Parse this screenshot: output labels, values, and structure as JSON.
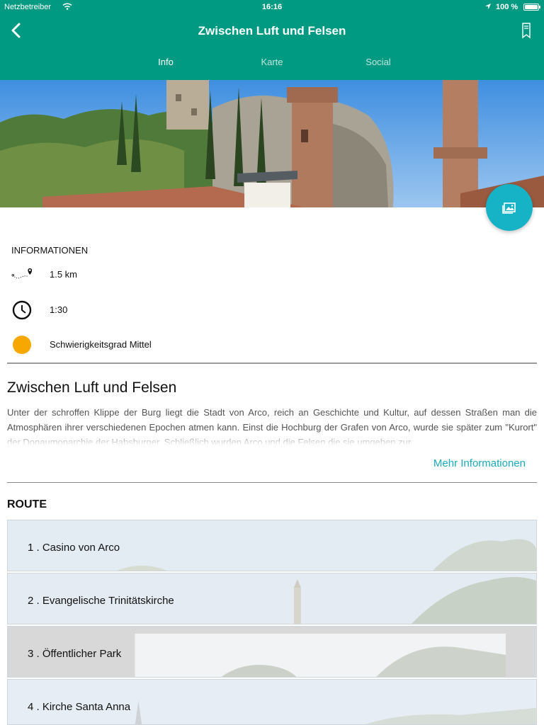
{
  "status_bar": {
    "carrier": "Netzbetreiber",
    "time": "16:16",
    "battery": "100 %"
  },
  "nav": {
    "title": "Zwischen Luft und Felsen",
    "back_icon": "chevron-left-icon",
    "bookmark_icon": "bookmark-icon"
  },
  "tabs": [
    {
      "label": "Info",
      "active": true
    },
    {
      "label": "Karte",
      "active": false
    },
    {
      "label": "Social",
      "active": false
    }
  ],
  "gallery_icon": "gallery-icon",
  "info": {
    "heading": "INFORMATIONEN",
    "distance": "1.5 km",
    "duration": "1:30",
    "difficulty": "Schwierigkeitsgrad Mittel",
    "difficulty_color": "#f6a800"
  },
  "tour": {
    "title": "Zwischen Luft und Felsen",
    "description": "Unter der schroffen Klippe der Burg liegt die Stadt von Arco, reich an Geschichte und Kultur, auf dessen Straßen man die Atmosphären ihrer verschiedenen Epochen atmen kann. Einst die Hochburg der Grafen von Arco, wurde sie später zum \"Kurort\" der Donaumonarchie der Habsburger. Schließlich wurden Arco und die Felsen die sie umgeben zur",
    "more_link": "Mehr Informationen"
  },
  "route": {
    "heading": "ROUTE",
    "items": [
      {
        "label": "1 . Casino von Arco"
      },
      {
        "label": "2 . Evangelische Trinitätskirche"
      },
      {
        "label": "3 . Öffentlicher Park"
      },
      {
        "label": "4 . Kirche Santa Anna"
      }
    ]
  },
  "colors": {
    "header": "#009a82",
    "accent": "#1aaab9",
    "fab": "#16b3c6"
  }
}
